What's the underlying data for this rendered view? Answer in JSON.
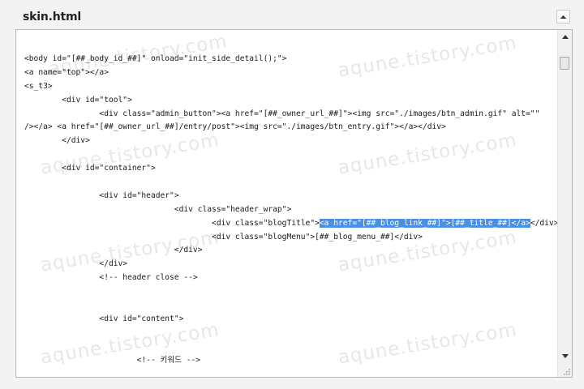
{
  "panel": {
    "title": "skin.html"
  },
  "watermark": {
    "text": "aqune.tistory.com"
  },
  "editor": {
    "lines": [
      {
        "before": "<body id=\"[##_body_id_##]\" onload=\"init_side_detail();\">",
        "highlight": "",
        "after": ""
      },
      {
        "before": "<a name=\"top\"></a>",
        "highlight": "",
        "after": ""
      },
      {
        "before": "<s_t3>",
        "highlight": "",
        "after": ""
      },
      {
        "before": "        <div id=\"tool\">",
        "highlight": "",
        "after": ""
      },
      {
        "before": "                <div class=\"admin_button\"><a href=\"[##_owner_url_##]\"><img src=\"./images/btn_admin.gif\" alt=\"\"",
        "highlight": "",
        "after": ""
      },
      {
        "before": "/></a> <a href=\"[##_owner_url_##]/entry/post\"><img src=\"./images/btn_entry.gif\"></a></div>",
        "highlight": "",
        "after": ""
      },
      {
        "before": "        </div>",
        "highlight": "",
        "after": ""
      },
      {
        "before": "",
        "highlight": "",
        "after": ""
      },
      {
        "before": "        <div id=\"container\">",
        "highlight": "",
        "after": ""
      },
      {
        "before": "",
        "highlight": "",
        "after": ""
      },
      {
        "before": "                <div id=\"header\">",
        "highlight": "",
        "after": ""
      },
      {
        "before": "                                <div class=\"header_wrap\">",
        "highlight": "",
        "after": ""
      },
      {
        "before": "                                        <div class=\"blogTitle\">",
        "highlight": "<a href=\"[##_blog_link_##]\">[##_title_##]</a>",
        "after": "</div>"
      },
      {
        "before": "                                        <div class=\"blogMenu\">[##_blog_menu_##]</div>",
        "highlight": "",
        "after": ""
      },
      {
        "before": "                                </div>",
        "highlight": "",
        "after": ""
      },
      {
        "before": "                </div>",
        "highlight": "",
        "after": ""
      },
      {
        "before": "                <!-- header close -->",
        "highlight": "",
        "after": ""
      },
      {
        "before": "",
        "highlight": "",
        "after": ""
      },
      {
        "before": "",
        "highlight": "",
        "after": ""
      },
      {
        "before": "                <div id=\"content\">",
        "highlight": "",
        "after": ""
      },
      {
        "before": "",
        "highlight": "",
        "after": ""
      },
      {
        "before": "",
        "highlight": "",
        "after": ""
      },
      {
        "before": "                        <!-- 키워드 -->",
        "highlight": "",
        "after": ""
      }
    ]
  },
  "icons": {
    "collapse": "chevron-up-icon",
    "scroll_up": "triangle-up-icon",
    "scroll_down": "triangle-down-icon",
    "resize": "resize-grip-icon"
  },
  "colors": {
    "selection": "#4a90e2",
    "border": "#b9b9b9",
    "background": "#f3f3f3"
  }
}
